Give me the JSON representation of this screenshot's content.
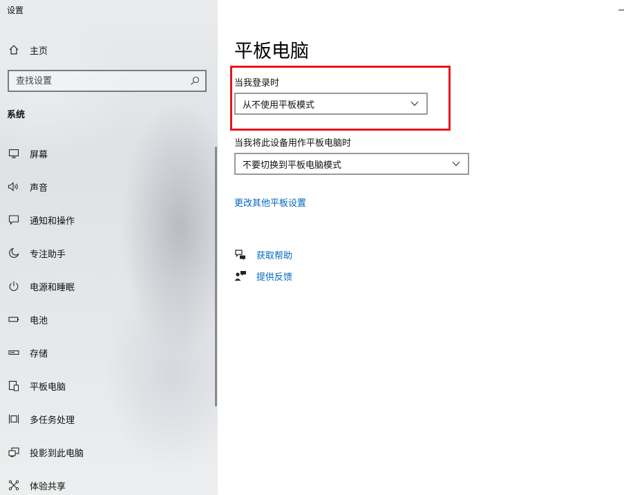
{
  "window": {
    "title": "设置"
  },
  "sidebar": {
    "home_label": "主页",
    "search": {
      "placeholder": "查找设置",
      "value": ""
    },
    "section_title": "系统",
    "items": [
      {
        "label": "屏幕",
        "icon": "monitor-icon"
      },
      {
        "label": "声音",
        "icon": "speaker-icon"
      },
      {
        "label": "通知和操作",
        "icon": "notification-icon"
      },
      {
        "label": "专注助手",
        "icon": "moon-icon"
      },
      {
        "label": "电源和睡眠",
        "icon": "power-icon"
      },
      {
        "label": "电池",
        "icon": "battery-icon"
      },
      {
        "label": "存储",
        "icon": "storage-icon"
      },
      {
        "label": "平板电脑",
        "icon": "tablet-icon"
      },
      {
        "label": "多任务处理",
        "icon": "multitasking-icon"
      },
      {
        "label": "投影到此电脑",
        "icon": "projecting-icon"
      },
      {
        "label": "体验共享",
        "icon": "shared-experience-icon"
      }
    ]
  },
  "main": {
    "title": "平板电脑",
    "signin": {
      "label": "当我登录时",
      "selected": "从不使用平板模式"
    },
    "tablet_use": {
      "label": "当我将此设备用作平板电脑时",
      "selected": "不要切换到平板电脑模式"
    },
    "more_settings_link": "更改其他平板设置",
    "help": {
      "get_help": "获取帮助",
      "give_feedback": "提供反馈"
    }
  },
  "colors": {
    "accent_link": "#0067c0",
    "highlight_border": "#e8161c"
  }
}
